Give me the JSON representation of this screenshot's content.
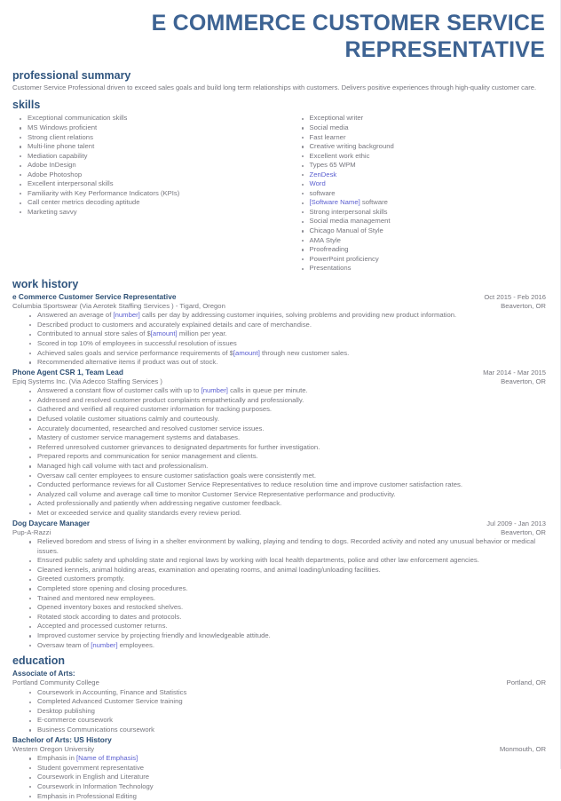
{
  "document": {
    "title": "E COMMERCE CUSTOMER SERVICE REPRESENTATIVE",
    "accent_color": "#3d6393",
    "heading_color": "#31567f",
    "body_color": "#76767e",
    "placeholder_color": "#5b5fd0"
  },
  "sections": {
    "summary": {
      "heading": "professional summary",
      "text": "Customer Service Professional  driven to exceed sales goals and build long term relationships with customers. Delivers positive experiences through high-quality customer care."
    },
    "skills": {
      "heading": "skills",
      "left": [
        {
          "text": "Exceptional communication skills",
          "placeholder": false
        },
        {
          "text": "MS Windows proficient",
          "placeholder": false
        },
        {
          "text": "Strong client relations",
          "placeholder": false
        },
        {
          "text": "Multi-line phone talent",
          "placeholder": false
        },
        {
          "text": "Mediation capability",
          "placeholder": false
        },
        {
          "text": "Adobe InDesign",
          "placeholder": false
        },
        {
          "text": "Adobe Photoshop",
          "placeholder": false
        },
        {
          "text": "Excellent interpersonal skills",
          "placeholder": false
        },
        {
          "text": "Familiarity with Key Performance Indicators (KPIs)",
          "placeholder": false
        },
        {
          "text": "Call center metrics decoding aptitude",
          "placeholder": false
        },
        {
          "text": "Marketing savvy",
          "placeholder": false
        }
      ],
      "right": [
        {
          "text": "Exceptional writer",
          "placeholder": false
        },
        {
          "text": "Social media",
          "placeholder": false
        },
        {
          "text": "Fast learner",
          "placeholder": false
        },
        {
          "text": "Creative writing background",
          "placeholder": false
        },
        {
          "text": "Excellent work ethic",
          "placeholder": false
        },
        {
          "text": "Types 65 WPM",
          "placeholder": false
        },
        {
          "text": "ZenDesk",
          "placeholder": true
        },
        {
          "text": "Word",
          "placeholder": true
        },
        {
          "text": "software",
          "placeholder": false
        },
        {
          "text": "[Software Name] software",
          "placeholder": "prefix",
          "prefix": "[Software Name]",
          "suffix": " software"
        },
        {
          "text": "Strong interpersonal skills",
          "placeholder": false
        },
        {
          "text": "Social media management",
          "placeholder": false
        },
        {
          "text": "Chicago Manual of Style",
          "placeholder": false
        },
        {
          "text": "AMA Style",
          "placeholder": false
        },
        {
          "text": "Proofreading",
          "placeholder": false
        },
        {
          "text": "PowerPoint proficiency",
          "placeholder": false
        },
        {
          "text": "Presentations",
          "placeholder": false
        }
      ]
    },
    "work_history": {
      "heading": "work history",
      "jobs": [
        {
          "title": "e Commerce Customer Service Representative",
          "dates": "Oct 2015 - Feb 2016",
          "company": "Columbia Sportswear (Via Aerotek Staffing Services ) - Tigard, Oregon",
          "location": "Beaverton, OR",
          "bullets": [
            {
              "pre": "Answered an average of ",
              "ph": "[number]",
              "post": " calls per day by addressing customer inquiries, solving problems and providing new product information."
            },
            {
              "pre": "Described product to customers and accurately explained details and care of merchandise.",
              "ph": "",
              "post": ""
            },
            {
              "pre": "Contributed to annual store sales of $",
              "ph": "[amount]",
              "post": " million per year."
            },
            {
              "pre": "Scored in top 10% of employees in successful resolution of issues",
              "ph": "",
              "post": ""
            },
            {
              "pre": "Achieved sales goals and service performance requirements of $",
              "ph": "[amount]",
              "post": " through new customer sales."
            },
            {
              "pre": "Recommended alternative items if product was out of stock.",
              "ph": "",
              "post": ""
            }
          ]
        },
        {
          "title": "Phone Agent CSR 1, Team Lead",
          "dates": "Mar 2014 - Mar 2015",
          "company": "Epiq Systems Inc. (Via Adecco Staffing Services )",
          "location": "Beaverton, OR",
          "bullets": [
            {
              "pre": "Answered a constant flow of customer calls with up to ",
              "ph": "[number]",
              "post": " calls in queue per minute."
            },
            {
              "pre": "Addressed and resolved customer product complaints empathetically and professionally.",
              "ph": "",
              "post": ""
            },
            {
              "pre": "Gathered and verified all required customer information for tracking purposes.",
              "ph": "",
              "post": ""
            },
            {
              "pre": "Defused volatile customer situations calmly and courteously.",
              "ph": "",
              "post": ""
            },
            {
              "pre": "Accurately documented, researched and resolved customer service issues.",
              "ph": "",
              "post": ""
            },
            {
              "pre": "Mastery of customer service management systems and databases.",
              "ph": "",
              "post": ""
            },
            {
              "pre": "Referred unresolved customer grievances to designated departments for further investigation.",
              "ph": "",
              "post": ""
            },
            {
              "pre": "Prepared reports and communication for senior management and clients.",
              "ph": "",
              "post": ""
            },
            {
              "pre": "Managed high call volume with tact and professionalism.",
              "ph": "",
              "post": ""
            },
            {
              "pre": "Oversaw call center employees to ensure customer satisfaction goals were consistently met.",
              "ph": "",
              "post": ""
            },
            {
              "pre": "Conducted performance reviews for all Customer Service Representatives to reduce resolution time and improve customer satisfaction rates.",
              "ph": "",
              "post": ""
            },
            {
              "pre": "Analyzed call volume and average call time to monitor Customer Service Representative performance and productivity.",
              "ph": "",
              "post": ""
            },
            {
              "pre": "Acted professionally and patiently when addressing negative customer feedback.",
              "ph": "",
              "post": ""
            },
            {
              "pre": "Met or exceeded service and quality standards every review period.",
              "ph": "",
              "post": ""
            }
          ]
        },
        {
          "title": "Dog Daycare Manager",
          "dates": "Jul 2009 - Jan 2013",
          "company": "Pup-A-Razzi",
          "location": "Beaverton, OR",
          "bullets": [
            {
              "pre": "Relieved boredom and stress of living in a shelter environment by walking, playing and tending to dogs. Recorded activity and noted any unusual behavior or medical issues.",
              "ph": "",
              "post": ""
            },
            {
              "pre": "Ensured public safety and upholding state and regional laws by working with local health departments, police and other law enforcement agencies.",
              "ph": "",
              "post": ""
            },
            {
              "pre": "Cleaned kennels, animal holding areas, examination and operating rooms, and animal loading/unloading facilities.",
              "ph": "",
              "post": ""
            },
            {
              "pre": "Greeted customers promptly.",
              "ph": "",
              "post": ""
            },
            {
              "pre": "Completed store opening and closing procedures.",
              "ph": "",
              "post": ""
            },
            {
              "pre": "Trained and mentored new employees.",
              "ph": "",
              "post": ""
            },
            {
              "pre": "Opened inventory boxes and restocked shelves.",
              "ph": "",
              "post": ""
            },
            {
              "pre": "Rotated stock according to dates and protocols.",
              "ph": "",
              "post": ""
            },
            {
              "pre": "Accepted and processed customer returns.",
              "ph": "",
              "post": ""
            },
            {
              "pre": "Improved customer service by projecting friendly and knowledgeable attitude.",
              "ph": "",
              "post": ""
            },
            {
              "pre": "Oversaw team of ",
              "ph": "[number]",
              "post": " employees."
            }
          ]
        }
      ]
    },
    "education": {
      "heading": "education",
      "entries": [
        {
          "degree": "Associate of Arts",
          "degree_suffix": ":",
          "school": "Portland Community College",
          "location": "Portland, OR",
          "bullets": [
            {
              "pre": "Coursework in Accounting, Finance and Statistics",
              "ph": "",
              "post": ""
            },
            {
              "pre": "Completed Advanced Customer Service training",
              "ph": "",
              "post": ""
            },
            {
              "pre": "Desktop publishing",
              "ph": "",
              "post": ""
            },
            {
              "pre": "E-commerce coursework",
              "ph": "",
              "post": ""
            },
            {
              "pre": "Business Communications coursework",
              "ph": "",
              "post": ""
            }
          ]
        },
        {
          "degree": "Bachelor of Arts: US History",
          "degree_suffix": "",
          "school": "Western Oregon University",
          "location": "Monmouth, OR",
          "bullets": [
            {
              "pre": "Emphasis in ",
              "ph": "[Name of Emphasis]",
              "post": ""
            },
            {
              "pre": "Student government representative",
              "ph": "",
              "post": ""
            },
            {
              "pre": "Coursework in English and Literature",
              "ph": "",
              "post": ""
            },
            {
              "pre": "Coursework in Information Technology",
              "ph": "",
              "post": ""
            },
            {
              "pre": "Emphasis in Professional Editing",
              "ph": "",
              "post": ""
            }
          ]
        }
      ]
    }
  }
}
